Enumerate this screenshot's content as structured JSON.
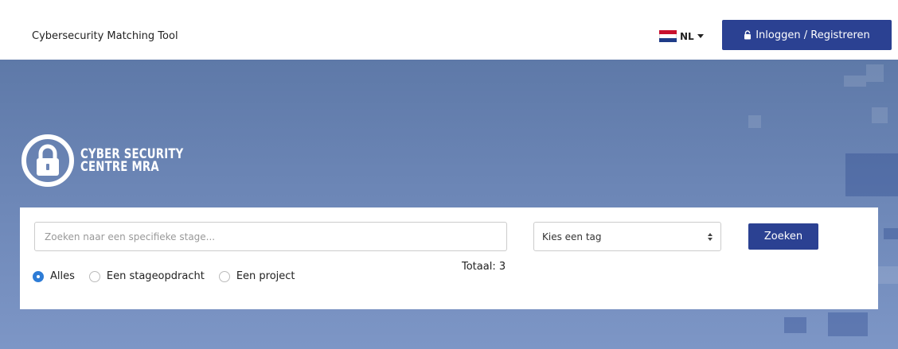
{
  "navbar": {
    "brand": "Cybersecurity Matching Tool",
    "language": "NL",
    "login_label": "Inloggen / Registreren"
  },
  "hero": {
    "logo_line1": "CYBER SECURITY",
    "logo_line2": "CENTRE MRA"
  },
  "search": {
    "placeholder": "Zoeken naar een specifieke stage...",
    "value": "",
    "tag_select": "Kies een tag",
    "button_label": "Zoeken",
    "total_label": "Totaal: 3",
    "filters": [
      {
        "label": "Alles",
        "checked": true
      },
      {
        "label": "Een stageopdracht",
        "checked": false
      },
      {
        "label": "Een project",
        "checked": false
      }
    ]
  },
  "colors": {
    "primary": "#2b4192",
    "radio_active": "#2e7cd6",
    "hero_bg": "#6c86b6"
  },
  "icons": [
    "lock-icon",
    "flag-nl-icon",
    "caret-down-icon",
    "padlock-logo-icon",
    "select-arrows-icon"
  ]
}
